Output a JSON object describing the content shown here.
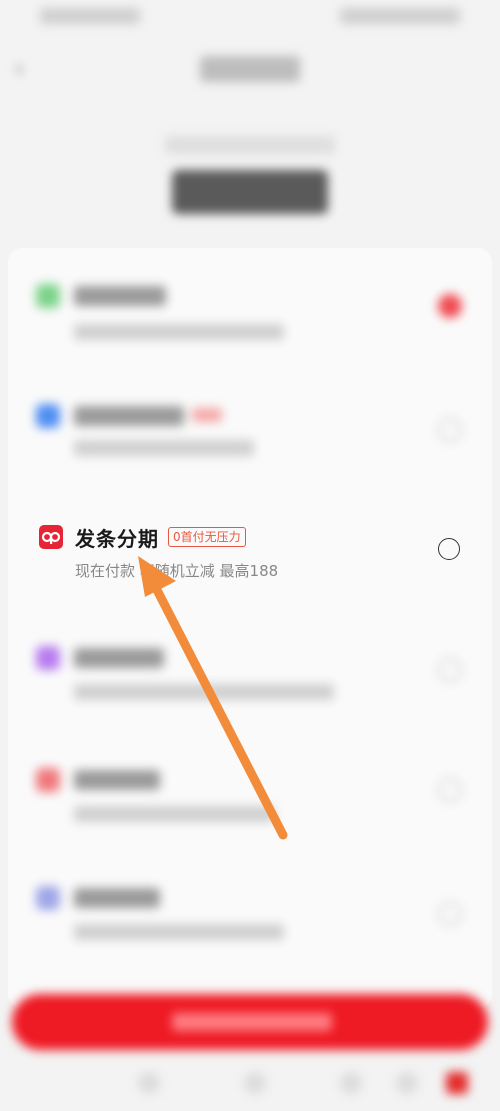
{
  "option": {
    "title": "发条分期",
    "badge": "0首付无压力",
    "desc": "现在付款 享随机立减 最高188"
  },
  "colors": {
    "accent": "#ee1a24",
    "badge": "#e8573f"
  },
  "icons": {
    "back": "chevron-left-icon",
    "option": "fenqi-logo-icon"
  }
}
